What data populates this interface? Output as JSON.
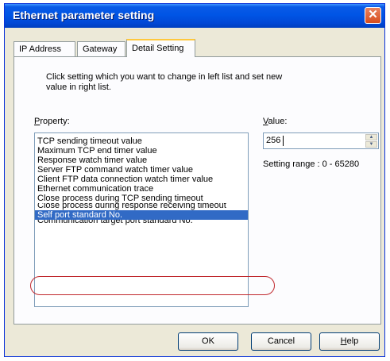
{
  "window": {
    "title": "Ethernet parameter setting",
    "close_glyph": "✕"
  },
  "tabs": [
    {
      "label": "IP Address"
    },
    {
      "label": "Gateway"
    },
    {
      "label": "Detail Setting",
      "active": true
    }
  ],
  "detail": {
    "instructions": "Click setting which you want to change in left list and set new value in right list.",
    "property_label": "Property:",
    "value_label": "Value:",
    "properties": [
      "TCP sending timeout value",
      "Maximum TCP end timer value",
      "Response watch timer value",
      "Server FTP command watch timer value",
      "Client FTP data connection watch timer value",
      "Ethernet communication trace",
      "Close process during TCP sending timeout",
      "Close process during response receiving timeout",
      "Self port standard No.",
      "Communication target port standard No."
    ],
    "selected_property": "Self port standard No.",
    "value": "256",
    "range_text": "Setting range : 0 - 65280"
  },
  "buttons": {
    "ok": "OK",
    "cancel": "Cancel",
    "help": "Help"
  },
  "colors": {
    "title_bar": "#0055e5",
    "selection": "#316ac5",
    "highlight_ring": "#c0282d",
    "tab_accent": "#ffc83c"
  }
}
